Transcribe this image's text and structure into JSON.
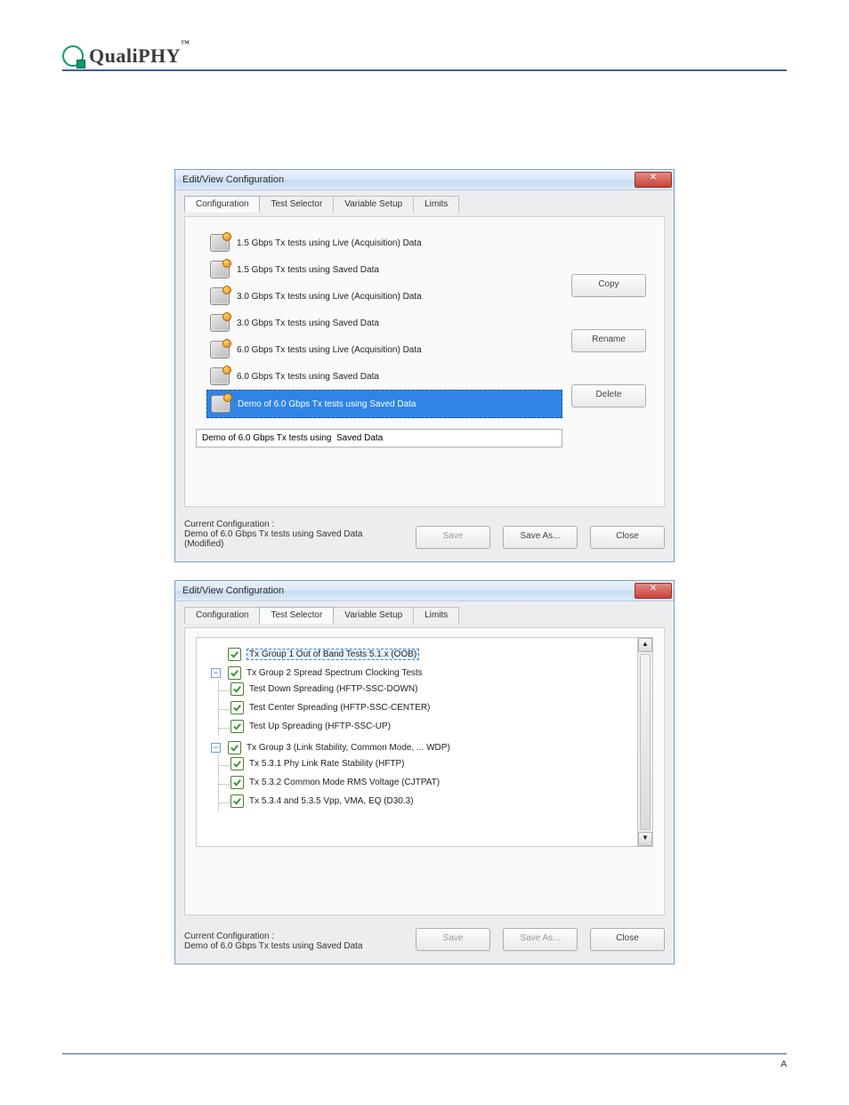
{
  "brand": {
    "name": "QualiPHY"
  },
  "dialog1": {
    "title": "Edit/View Configuration",
    "tabs": [
      "Configuration",
      "Test Selector",
      "Variable Setup",
      "Limits"
    ],
    "active_tab": 0,
    "configurations": [
      "1.5 Gbps Tx tests using Live (Acquisition) Data",
      "1.5 Gbps Tx tests using Saved Data",
      "3.0 Gbps Tx tests using Live (Acquisition) Data",
      "3.0 Gbps Tx tests using Saved Data",
      "6.0 Gbps Tx tests using Live (Acquisition) Data",
      "6.0 Gbps Tx tests using Saved Data",
      "Demo of 6.0 Gbps Tx tests using  Saved Data"
    ],
    "selected_index": 6,
    "name_input_value": "Demo of 6.0 Gbps Tx tests using  Saved Data",
    "side_buttons": {
      "copy": "Copy",
      "rename": "Rename",
      "delete": "Delete"
    },
    "footer": {
      "label": "Current Configuration :",
      "value": "Demo of 6.0 Gbps Tx tests using  Saved Data  (Modified)",
      "save": "Save",
      "save_as": "Save As...",
      "close": "Close"
    }
  },
  "dialog2": {
    "title": "Edit/View Configuration",
    "tabs": [
      "Configuration",
      "Test Selector",
      "Variable Setup",
      "Limits"
    ],
    "active_tab": 1,
    "tree": {
      "g1": {
        "label": "Tx Group 1 Out of Band Tests 5.1.x  (OOB)",
        "checked": true,
        "selected": true
      },
      "g2": {
        "label": "Tx Group 2 Spread Spectrum Clocking Tests",
        "checked": true,
        "children": {
          "a": {
            "label": "Test Down Spreading (HFTP-SSC-DOWN)",
            "checked": true
          },
          "b": {
            "label": "Test Center Spreading (HFTP-SSC-CENTER)",
            "checked": true
          },
          "c": {
            "label": "Test Up Spreading (HFTP-SSC-UP)",
            "checked": true
          }
        }
      },
      "g3": {
        "label": "Tx Group 3 (Link Stability, Common Mode, ... WDP)",
        "checked": true,
        "children": {
          "a": {
            "label": "Tx 5.3.1 Phy Link Rate Stability (HFTP)",
            "checked": true
          },
          "b": {
            "label": "Tx 5.3.2 Common Mode RMS Voltage (CJTPAT)",
            "checked": true
          },
          "c": {
            "label": "Tx 5.3.4  and 5.3.5 Vpp, VMA, EQ (D30.3)",
            "checked": true
          }
        }
      }
    },
    "footer": {
      "label": "Current Configuration :",
      "value": "Demo of 6.0 Gbps Tx tests using  Saved Data",
      "save": "Save",
      "save_as": "Save As...",
      "close": "Close"
    }
  },
  "page_footer": "A"
}
